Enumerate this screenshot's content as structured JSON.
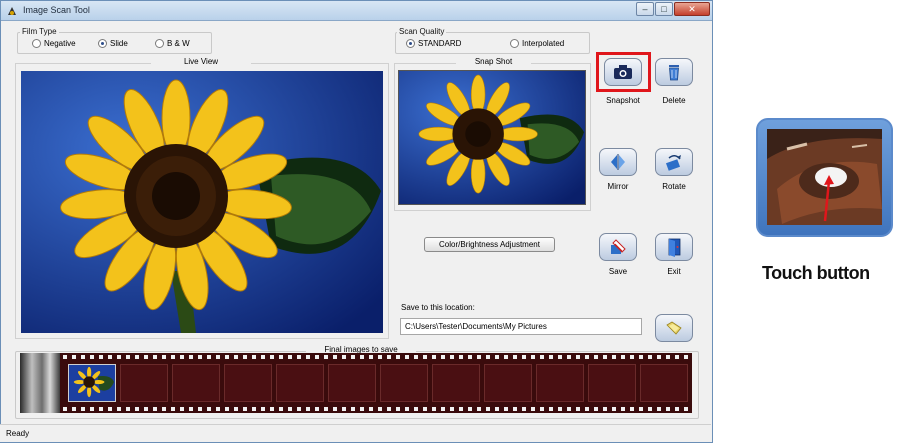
{
  "window": {
    "title": "Image Scan Tool"
  },
  "window_controls": {
    "minimize": "–",
    "maximize": "□",
    "close": "✕"
  },
  "film_type": {
    "label": "Film Type",
    "options": [
      {
        "label": "Negative",
        "selected": false
      },
      {
        "label": "Slide",
        "selected": true
      },
      {
        "label": "B & W",
        "selected": false
      }
    ]
  },
  "scan_quality": {
    "label": "Scan Quality",
    "options": [
      {
        "label": "STANDARD",
        "selected": true
      },
      {
        "label": "Interpolated",
        "selected": false
      }
    ]
  },
  "live_view": {
    "label": "Live View"
  },
  "snap_shot": {
    "label": "Snap Shot"
  },
  "tools": {
    "snapshot": {
      "label": "Snapshot",
      "icon": "camera-icon",
      "highlighted": true
    },
    "delete": {
      "label": "Delete",
      "icon": "trash-icon"
    },
    "mirror": {
      "label": "Mirror",
      "icon": "mirror-icon"
    },
    "rotate": {
      "label": "Rotate",
      "icon": "rotate-icon"
    },
    "save": {
      "label": "Save",
      "icon": "save-icon"
    },
    "exit": {
      "label": "Exit",
      "icon": "exit-icon"
    }
  },
  "color_button": {
    "label": "Color/Brightness Adjustment"
  },
  "save_location": {
    "label": "Save to this location:",
    "path": "C:\\Users\\Tester\\Documents\\My Pictures",
    "browse_icon": "folder-icon"
  },
  "final_images": {
    "label": "Final images to save"
  },
  "status": {
    "text": "Ready"
  },
  "inset": {
    "caption": "Touch button",
    "highlight_color": "#e0161b"
  }
}
